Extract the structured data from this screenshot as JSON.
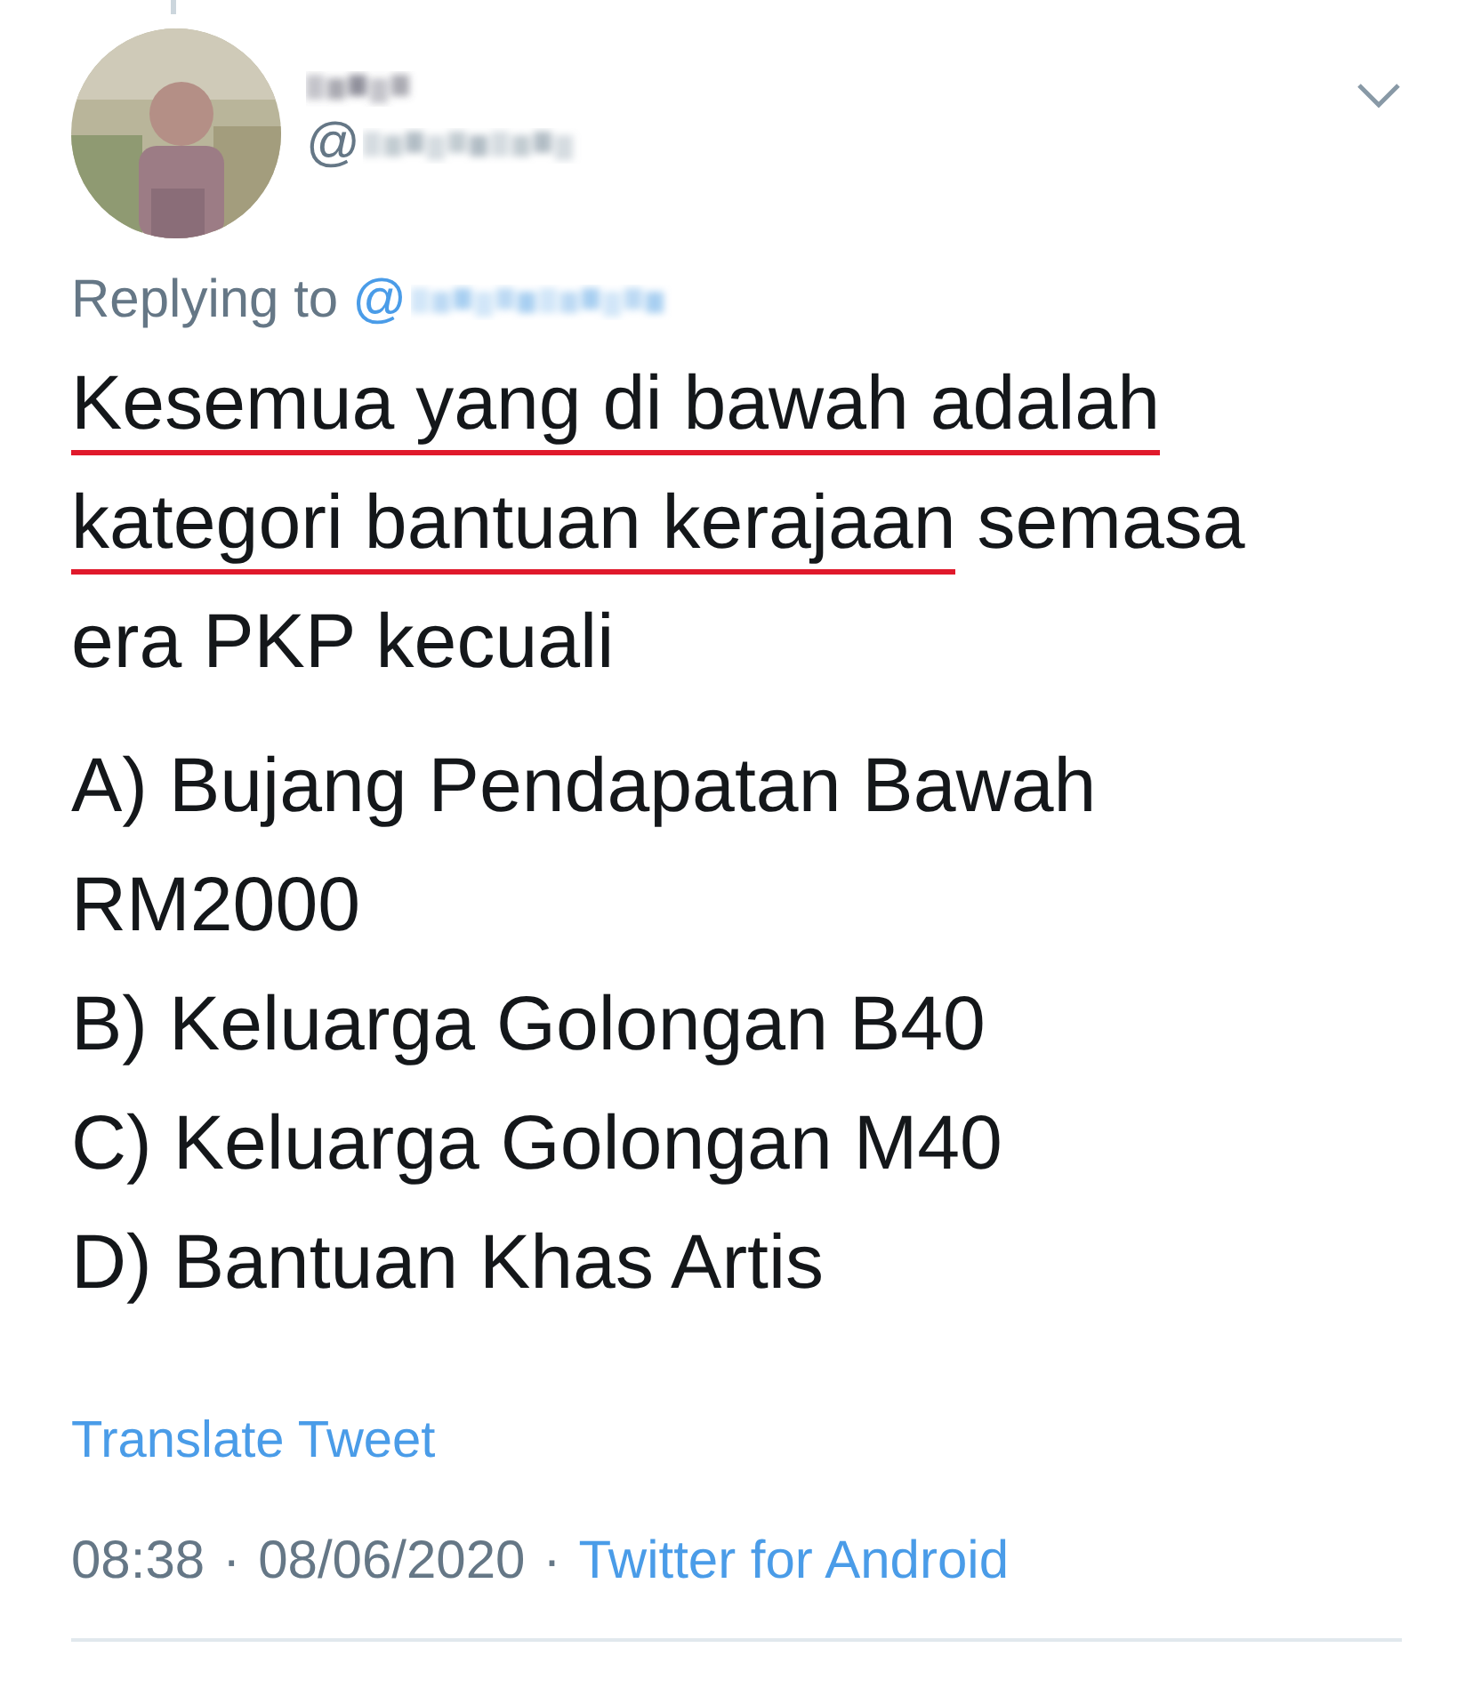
{
  "author": {
    "handle_prefix": "@"
  },
  "reply_line": {
    "label": "Replying to",
    "mention_prefix": "@"
  },
  "tweet_lines": [
    [
      {
        "text": "Kesemua yang di bawah adalah",
        "underlined": true
      }
    ],
    [
      {
        "text": "kategori bantuan kerajaan",
        "underlined": true
      },
      {
        "text": " semasa",
        "underlined": false
      }
    ],
    [
      {
        "text": "era PKP kecuali",
        "underlined": false
      }
    ]
  ],
  "options": [
    "A) Bujang Pendapatan Bawah RM2000",
    "B) Keluarga Golongan B40",
    "C) Keluarga Golongan M40",
    "D) Bantuan Khas Artis"
  ],
  "translate_link": "Translate Tweet",
  "meta": {
    "time": "08:38",
    "separator_1": "·",
    "date": "08/06/2020",
    "separator_2": "·",
    "source": "Twitter for Android"
  }
}
